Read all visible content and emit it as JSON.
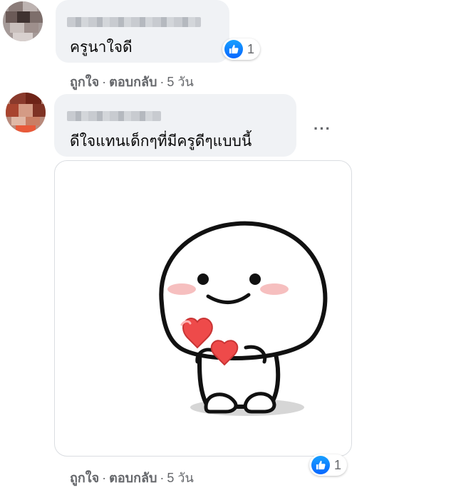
{
  "comments": [
    {
      "text": "ครูนาใจดี",
      "reactions": {
        "icon": "like-icon",
        "count": "1"
      },
      "actions": {
        "like": "ถูกใจ",
        "separator": "·",
        "reply": "ตอบกลับ",
        "time": "5 วัน"
      }
    },
    {
      "text": "ดีใจแทนเด็กๆที่มีครูดีๆแบบนี้",
      "more_label": "···",
      "sticker": {
        "icon": "cute-character-holding-hearts-sticker"
      },
      "reactions": {
        "icon": "like-icon",
        "count": "1"
      },
      "actions": {
        "like": "ถูกใจ",
        "separator": "·",
        "reply": "ตอบกลับ",
        "time": "5 วัน"
      }
    }
  ],
  "colors": {
    "bubble": "#f0f2f5",
    "like_blue": "#0866ff",
    "meta_text": "#65676b",
    "heart": "#ee4a4a",
    "blush": "#f4b4b4"
  }
}
